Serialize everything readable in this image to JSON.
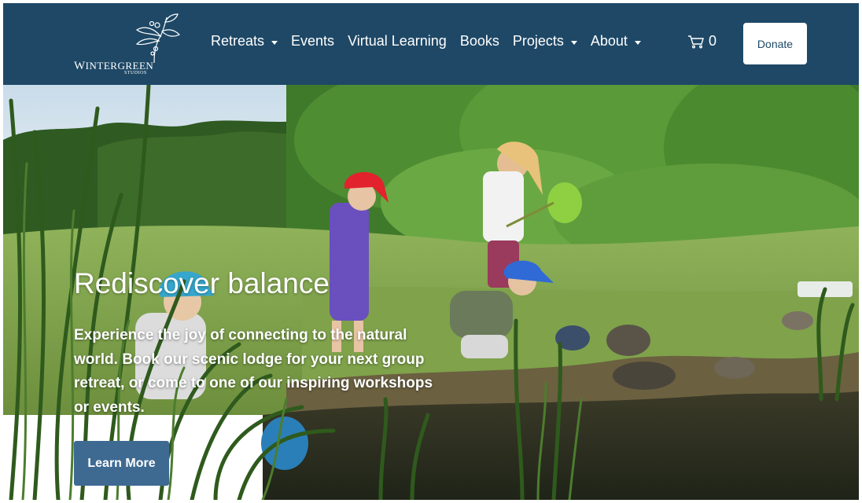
{
  "header": {
    "logo": {
      "name": "Wintergreen",
      "sub": "STUDIOS",
      "icon": "wintergreen-plant-logo"
    },
    "nav": {
      "retreats": "Retreats",
      "events": "Events",
      "virtual_learning": "Virtual Learning",
      "books": "Books",
      "projects": "Projects",
      "about": "About"
    },
    "cart": {
      "icon": "cart-icon",
      "count": "0"
    },
    "donate_label": "Donate"
  },
  "hero": {
    "title": "Rediscover balance",
    "text": "Experience the joy of connecting to the natural world. Book our scenic lodge for your next group retreat, or come to one of our inspiring workshops or events.",
    "cta_label": "Learn More",
    "image": "children-netting-at-pond-photo"
  },
  "colors": {
    "header_bg": "#1e4866",
    "button_bg": "#3e6a92",
    "donate_bg": "#ffffff"
  }
}
